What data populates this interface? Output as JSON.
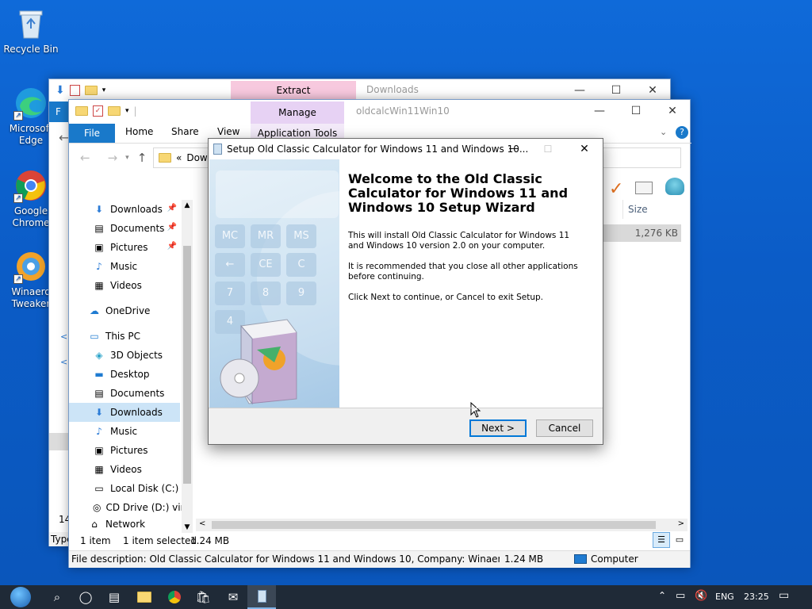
{
  "desktop": {
    "icons": [
      {
        "label": "Recycle Bin",
        "icon": "recycle-bin-icon"
      },
      {
        "label": "Microsoft Edge",
        "icon": "edge-icon"
      },
      {
        "label": "Google Chrome",
        "icon": "chrome-icon"
      },
      {
        "label": "Winaero Tweaker",
        "icon": "winaero-tweaker-icon"
      }
    ]
  },
  "back_window": {
    "context_tab": "Extract",
    "title": "Downloads",
    "ribbon_file": "F"
  },
  "explorer": {
    "context_group": "Manage",
    "context_tab": "Application Tools",
    "title": "oldcalcWin11Win10",
    "tabs": [
      "File",
      "Home",
      "Share",
      "View"
    ],
    "address_prefix": "«",
    "address_text": "Down",
    "nav": {
      "quick_access": [
        {
          "label": "Downloads",
          "icon": "download-arrow-icon"
        },
        {
          "label": "Documents",
          "icon": "documents-icon"
        },
        {
          "label": "Pictures",
          "icon": "pictures-icon"
        },
        {
          "label": "Music",
          "icon": "music-icon"
        },
        {
          "label": "Videos",
          "icon": "videos-icon"
        }
      ],
      "onedrive": "OneDrive",
      "this_pc": "This PC",
      "pc_items": [
        {
          "label": "3D Objects",
          "icon": "3d-objects-icon"
        },
        {
          "label": "Desktop",
          "icon": "desktop-icon"
        },
        {
          "label": "Documents",
          "icon": "documents-icon"
        },
        {
          "label": "Downloads",
          "icon": "download-arrow-icon"
        },
        {
          "label": "Music",
          "icon": "music-icon"
        },
        {
          "label": "Pictures",
          "icon": "pictures-icon"
        },
        {
          "label": "Videos",
          "icon": "videos-icon"
        },
        {
          "label": "Local Disk (C:)",
          "icon": "local-disk-icon"
        },
        {
          "label": "CD Drive (D:) virt",
          "icon": "cd-drive-icon"
        },
        {
          "label": "Network",
          "icon": "network-icon"
        }
      ]
    },
    "column_size": "Size",
    "file_size": "1,276 KB",
    "left_status_count": "14",
    "left_status_type": "Type",
    "status": {
      "count": "1 item",
      "selected": "1 item selected",
      "size": "1.24 MB"
    },
    "details_bar": {
      "description": "File description: Old Classic Calculator for Windows 11 and Windows 10, Company: Winaero, File versio",
      "size": "1.24 MB",
      "location": "Computer"
    }
  },
  "dialog": {
    "title": "Setup Old Classic Calculator for Windows 11 and Windows 10...",
    "heading": "Welcome to the Old Classic Calculator for Windows 11 and Windows 10 Setup Wizard",
    "para1": "This will install Old Classic Calculator for Windows 11 and Windows 10 version 2.0 on your computer.",
    "para2": "It is recommended that you close all other applications before continuing.",
    "para3": "Click Next to continue, or Cancel to exit Setup.",
    "next_label": "Next >",
    "cancel_label": "Cancel",
    "calc_keys": [
      "MC",
      "MR",
      "MS",
      "←",
      "CE",
      "C",
      "7",
      "8",
      "9",
      "4"
    ]
  },
  "taskbar": {
    "lang": "ENG",
    "time": "23:25"
  },
  "colors": {
    "desktop": "#0b5cc7",
    "accent": "#0078d7",
    "extract_tab": "#f7b8d6",
    "manage_tab": "#e3cbf1",
    "taskbar": "#1f2a37"
  }
}
